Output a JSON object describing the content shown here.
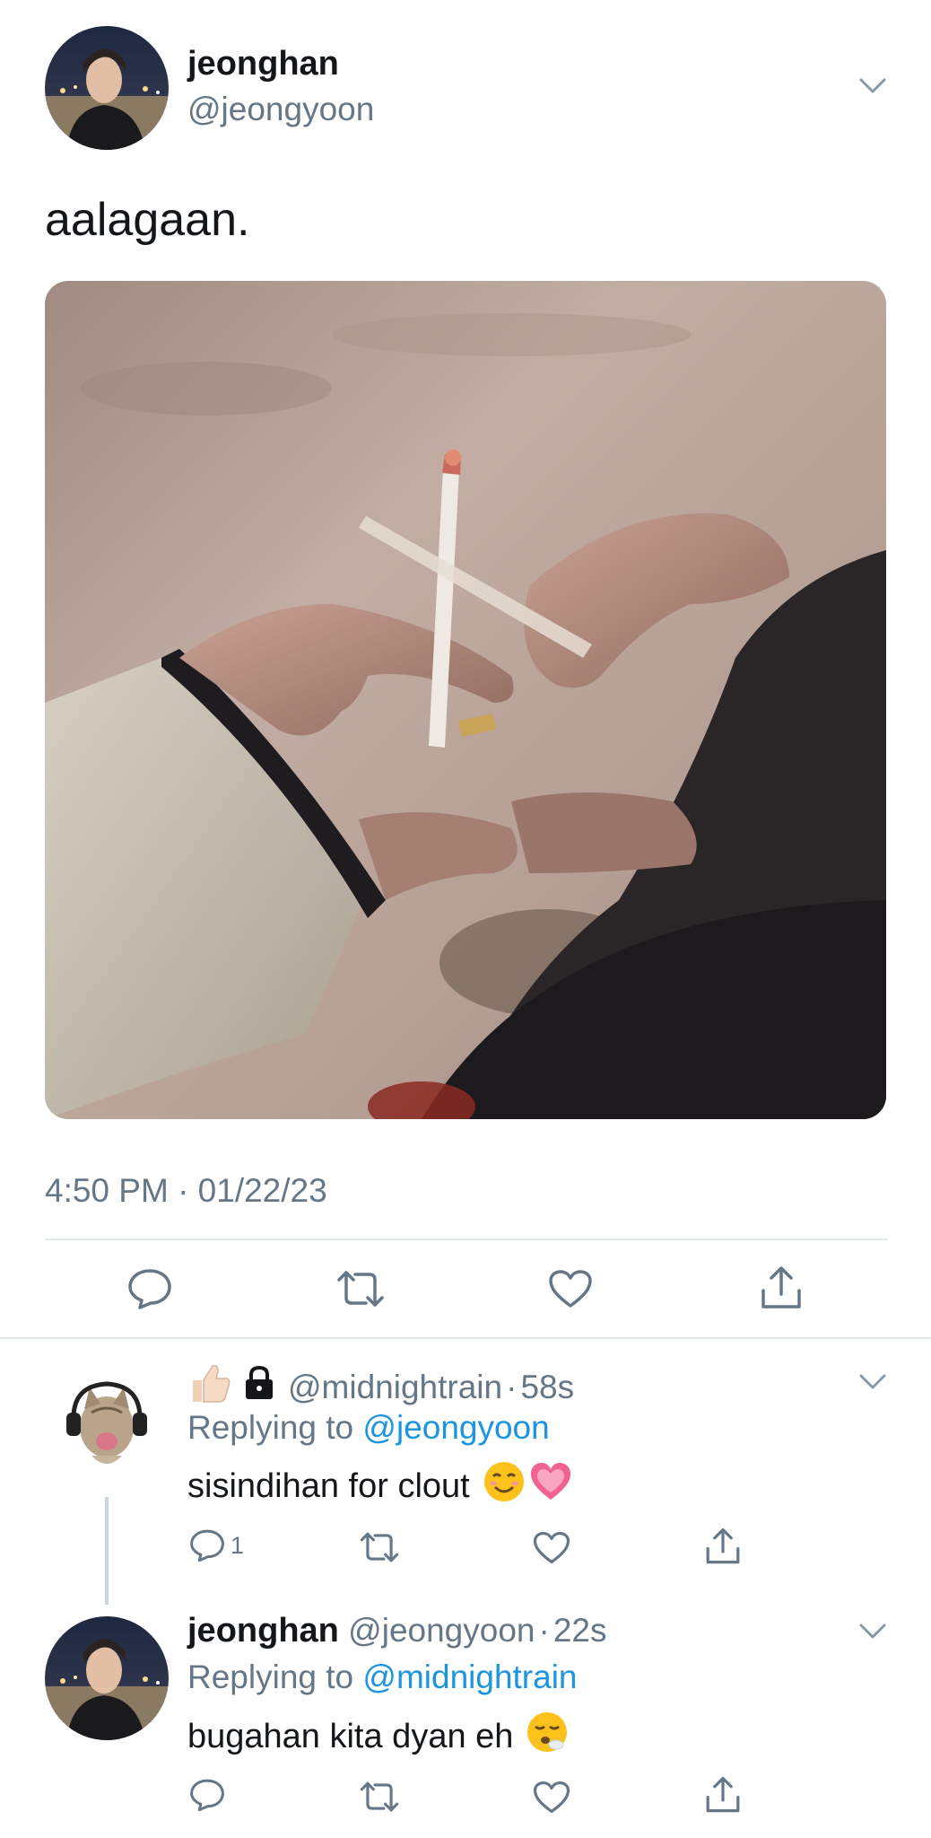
{
  "tweet": {
    "author_name": "jeonghan",
    "author_handle": "@jeongyoon",
    "text": "aalagaan.",
    "timestamp": "4:50 PM · 01/22/23",
    "media": "photo-two-hands-heart-with-cigarette",
    "actions": [
      "reply-icon",
      "retweet-icon",
      "like-icon",
      "share-icon"
    ]
  },
  "replies": [
    {
      "badges": [
        "thumbs-up-emoji",
        "lock-icon"
      ],
      "handle": "@midnightrain",
      "sep": "·",
      "time": "58s",
      "replying_label": "Replying to",
      "replying_to": "@jeongyoon",
      "text": "sisindihan for clout",
      "text_emojis": [
        "smiling-face-emoji",
        "growing-heart-emoji"
      ],
      "reply_count": "1"
    },
    {
      "author_name": "jeonghan",
      "handle": "@jeongyoon",
      "sep": "·",
      "time": "22s",
      "replying_label": "Replying to",
      "replying_to": "@midnightrain",
      "text": "bugahan kita dyan eh",
      "text_emojis": [
        "face-exhaling-emoji"
      ]
    }
  ],
  "colors": {
    "text": "#14171a",
    "muted": "#657786",
    "link": "#1b95e0",
    "divider": "#e1e8ed"
  }
}
